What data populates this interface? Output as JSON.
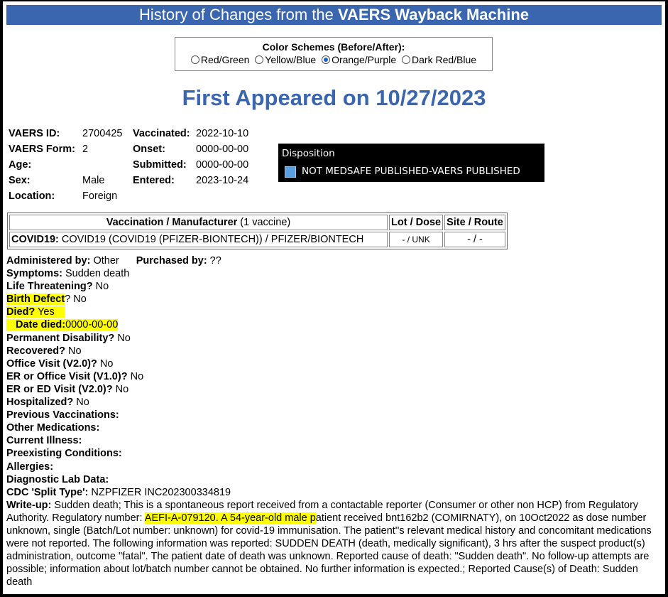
{
  "header": {
    "title_prefix": "History of Changes from the ",
    "title_bold": "VAERS Wayback Machine"
  },
  "color_schemes": {
    "heading": "Color Schemes (Before/After):",
    "options": [
      {
        "label": "Red/Green",
        "selected": false
      },
      {
        "label": "Yellow/Blue",
        "selected": false
      },
      {
        "label": "Orange/Purple",
        "selected": true
      },
      {
        "label": "Dark Red/Blue",
        "selected": false
      }
    ]
  },
  "first_appeared": "First Appeared on 10/27/2023",
  "record": {
    "vaers_id_label": "VAERS ID:",
    "vaers_id": "2700425",
    "form_label": "VAERS Form:",
    "form": "2",
    "age_label": "Age:",
    "age": "",
    "sex_label": "Sex:",
    "sex": "Male",
    "location_label": "Location:",
    "location": "Foreign",
    "vaccinated_label": "Vaccinated:",
    "vaccinated": "2022-10-10",
    "onset_label": "Onset:",
    "onset": "0000-00-00",
    "submitted_label": "Submitted:",
    "submitted": "0000-00-00",
    "entered_label": "Entered:",
    "entered": "2023-10-24"
  },
  "disposition": {
    "heading": "Disposition",
    "value": "NOT MEDSAFE PUBLISHED-VAERS PUBLISHED",
    "color": "#5aa0e0"
  },
  "vaccine_table": {
    "col1_bold": "Vaccination / Manufacturer",
    "col1_rest": " (1 vaccine)",
    "col2": "Lot / Dose",
    "col3": "Site / Route",
    "row_bold": "COVID19:",
    "row_rest": " COVID19 (COVID19 (PFIZER-BIONTECH)) / PFIZER/BIONTECH",
    "lot": "- / UNK",
    "site": "- / -"
  },
  "details": {
    "administered_label": "Administered by:",
    "administered": " Other",
    "purchased_label": "Purchased by:",
    "purchased": " ??",
    "symptoms_label": "Symptoms:",
    "symptoms": " Sudden death",
    "life_label": "Life Threatening?",
    "life": " No",
    "birth_label": "Birth Defect",
    "birth": "? No",
    "died_label": "Died?",
    "died": " Yes",
    "date_died_label": "Date died:",
    "date_died": "0000-00-00",
    "perm_label": "Permanent Disability?",
    "perm": " No",
    "recovered_label": "Recovered?",
    "recovered": " No",
    "office_label": "Office Visit (V2.0)?",
    "office": " No",
    "er_office_label": "ER or Office Visit (V1.0)?",
    "er_office": " No",
    "er_ed_label": "ER or ED Visit (V2.0)?",
    "er_ed": " No",
    "hosp_label": "Hospitalized?",
    "hosp": " No",
    "prev_vax_label": "Previous Vaccinations:",
    "other_meds_label": "Other Medications:",
    "illness_label": "Current Illness:",
    "preexisting_label": "Preexisting Conditions:",
    "allergies_label": "Allergies:",
    "lab_label": "Diagnostic Lab Data:",
    "split_label": "CDC 'Split Type':",
    "split": " NZPFIZER INC202300334819",
    "writeup_label": "Write-up:",
    "writeup_1": " Sudden death; This is a spontaneous report received from a contactable reporter (Consumer or other non HCP) from Regulatory Authority. Regulatory number: ",
    "writeup_hl": "AEFI-A-079120. A 54-year-old male p",
    "writeup_2": "atient received bnt162b2 (COMIRNATY), on 10Oct2022 as dose number unknown, single (Batch/Lot number: unknown) for covid-19 immunisation. The patient''s relevant medical history and concomitant medications were not reported. The following information was reported: SUDDEN DEATH (death, medically significant), 3 hrs after the suspect product(s) administration, outcome \"fatal\". The patient date of death was unknown. Reported cause of death: \"Sudden death\". No follow-up attempts are possible; information about lot/batch number cannot be obtained. No further information is expected.; Reported Cause(s) of Death: Sudden death"
  },
  "highlight_color": "#ffff00"
}
